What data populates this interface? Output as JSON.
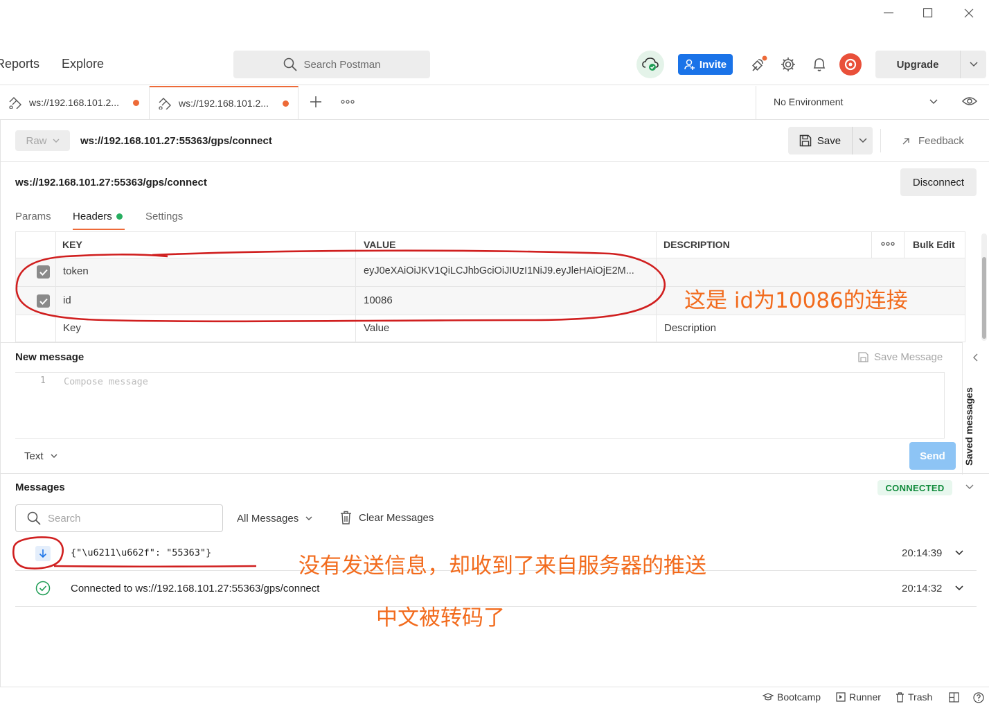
{
  "nav": {
    "reports": "Reports",
    "explore": "Explore",
    "search_placeholder": "Search Postman",
    "invite": "Invite",
    "upgrade": "Upgrade"
  },
  "tabs": [
    {
      "label": "ws://192.168.101.2..."
    },
    {
      "label": "ws://192.168.101.2..."
    }
  ],
  "environment": "No Environment",
  "request": {
    "mode": "Raw",
    "url": "ws://192.168.101.27:55363/gps/connect",
    "save": "Save",
    "feedback": "Feedback",
    "connection_url": "ws://192.168.101.27:55363/gps/connect",
    "disconnect": "Disconnect"
  },
  "subtabs": {
    "params": "Params",
    "headers": "Headers",
    "settings": "Settings"
  },
  "headers_table": {
    "columns": {
      "key": "KEY",
      "value": "VALUE",
      "description": "DESCRIPTION",
      "bulk_edit": "Bulk Edit"
    },
    "rows": [
      {
        "key": "token",
        "value": "eyJ0eXAiOiJKV1QiLCJhbGciOiJIUzI1NiJ9.eyJleHAiOjE2M...",
        "checked": true
      },
      {
        "key": "id",
        "value": "10086",
        "checked": true
      }
    ],
    "placeholders": {
      "key": "Key",
      "value": "Value",
      "description": "Description"
    }
  },
  "new_message": {
    "title": "New message",
    "save_message": "Save Message",
    "line_number": "1",
    "placeholder": "Compose message",
    "format": "Text",
    "send": "Send",
    "saved_messages": "Saved messages"
  },
  "messages": {
    "title": "Messages",
    "status": "CONNECTED",
    "search_placeholder": "Search",
    "filter": "All Messages",
    "clear": "Clear Messages",
    "items": [
      {
        "text": "{\"\\u6211\\u662f\": \"55363\"}",
        "time": "20:14:39",
        "kind": "incoming"
      },
      {
        "text": "Connected to ws://192.168.101.27:55363/gps/connect",
        "time": "20:14:32",
        "kind": "connected"
      }
    ]
  },
  "annotations": {
    "a1": "这是 id为10086的连接",
    "a2": "没有发送信息，却收到了来自服务器的推送",
    "a3": "中文被转码了",
    "color": "#f26b1d"
  },
  "statusbar": {
    "bootcamp": "Bootcamp",
    "runner": "Runner",
    "trash": "Trash"
  },
  "colors": {
    "accent": "#1a73e8",
    "tab_dot": "#ed6a38",
    "connected": "#0f8a3a",
    "annotation_circle": "#d01f1f"
  }
}
